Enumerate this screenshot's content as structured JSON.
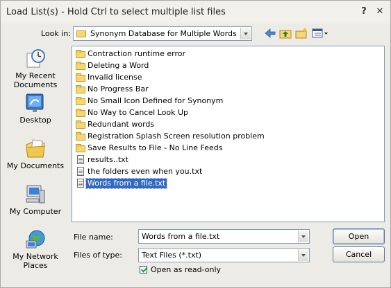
{
  "window": {
    "title": "Load List(s) - Hold Ctrl to select multiple list files",
    "help_label": "?",
    "close_label": "✕"
  },
  "lookin": {
    "label": "Look in:",
    "value": "Synonym Database for Multiple Words"
  },
  "toolbar": {
    "icons": [
      "back-icon",
      "up-folder-icon",
      "new-folder-icon",
      "view-menu-icon"
    ]
  },
  "places": [
    {
      "label": "My Recent Documents",
      "icon": "recent-documents-icon"
    },
    {
      "label": "Desktop",
      "icon": "desktop-icon"
    },
    {
      "label": "My Documents",
      "icon": "my-documents-icon"
    },
    {
      "label": "My Computer",
      "icon": "my-computer-icon"
    },
    {
      "label": "My Network Places",
      "icon": "network-places-icon"
    }
  ],
  "files": [
    {
      "name": "Contraction runtime error",
      "type": "folder"
    },
    {
      "name": "Deleting a Word",
      "type": "folder"
    },
    {
      "name": "Invalid license",
      "type": "folder"
    },
    {
      "name": "No Progress Bar",
      "type": "folder"
    },
    {
      "name": "No Small Icon Defined for Synonym",
      "type": "folder"
    },
    {
      "name": "No Way to Cancel Look Up",
      "type": "folder"
    },
    {
      "name": "Redundant words",
      "type": "folder"
    },
    {
      "name": "Registration Splash Screen resolution problem",
      "type": "folder"
    },
    {
      "name": "Save Results to File - No Line Feeds",
      "type": "folder"
    },
    {
      "name": "results..txt",
      "type": "text"
    },
    {
      "name": "the folders even when you.txt",
      "type": "text"
    },
    {
      "name": "Words from a file.txt",
      "type": "text",
      "selected": true
    }
  ],
  "filename": {
    "label": "File name:",
    "value": "Words from a file.txt"
  },
  "filetype": {
    "label": "Files of type:",
    "value": "Text Files (*.txt)"
  },
  "readonly": {
    "label": "Open as read-only",
    "checked": true
  },
  "buttons": {
    "open": "Open",
    "cancel": "Cancel"
  },
  "colors": {
    "selection": "#316ac5",
    "dialog_bg": "#ecebe6",
    "folder": "#f7d774"
  }
}
